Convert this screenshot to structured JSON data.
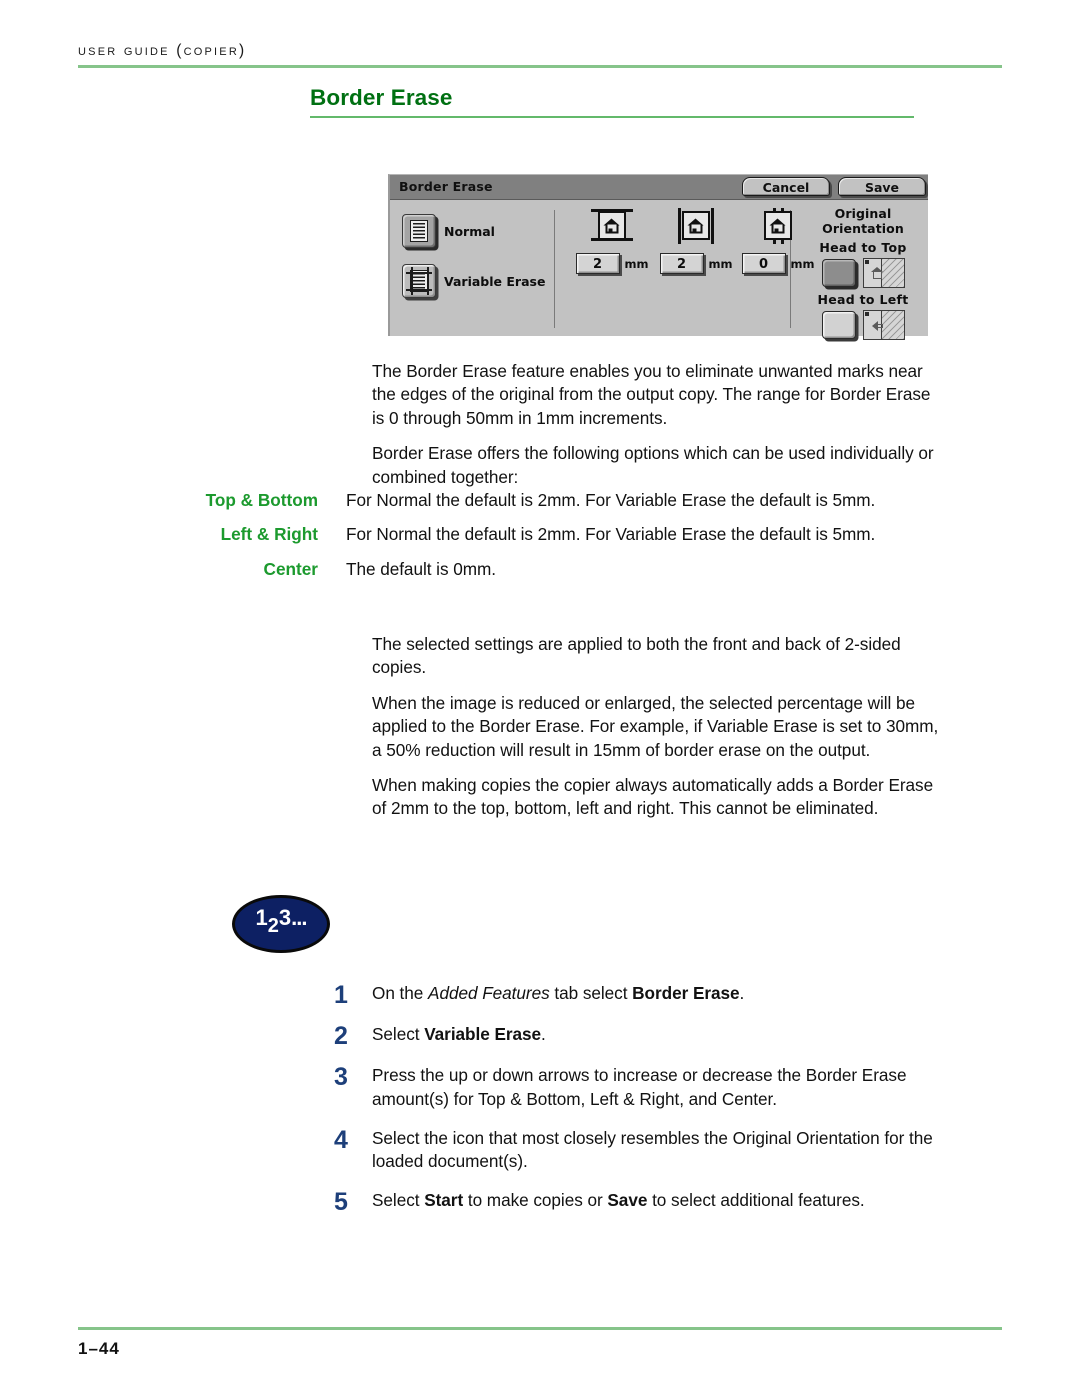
{
  "header": {
    "running_head": "User Guide (Copier)"
  },
  "section": {
    "title": "Border Erase"
  },
  "ui_panel": {
    "title": "Border Erase",
    "cancel_label": "Cancel",
    "save_label": "Save",
    "options": [
      {
        "label": "Normal",
        "selected": true,
        "icon": "document-icon"
      },
      {
        "label": "Variable Erase",
        "selected": false,
        "icon": "document-crop-marks-icon"
      }
    ],
    "amounts": [
      {
        "icon": "house-top-bottom-icon",
        "value": "2",
        "unit": "mm"
      },
      {
        "icon": "house-left-right-icon",
        "value": "2",
        "unit": "mm"
      },
      {
        "icon": "house-center-icon",
        "value": "0",
        "unit": "mm"
      }
    ],
    "orientation": {
      "heading": "Original Orientation",
      "head_to_top_label": "Head to Top",
      "head_to_left_label": "Head to Left",
      "head_to_top_selected": true,
      "head_to_left_selected": false
    }
  },
  "body": {
    "paragraphs_top": [
      "The Border Erase feature enables you to eliminate unwanted marks near the edges of the original from the output copy.  The range for Border Erase is 0 through 50mm in 1mm increments.",
      "Border Erase offers the following options which can be used individually or combined together:"
    ],
    "definitions": [
      {
        "term": "Top & Bottom",
        "description": "For Normal the default is 2mm. For Variable Erase the default is 5mm."
      },
      {
        "term": "Left & Right",
        "description": "For Normal the default is 2mm. For Variable Erase the default is 5mm."
      },
      {
        "term": "Center",
        "description": "The default is 0mm."
      }
    ],
    "paragraphs_bottom": [
      "The selected settings are applied to both the front and back of 2-sided copies.",
      "When the image is reduced or enlarged, the selected percentage will be applied to the Border Erase.  For example, if Variable Erase is set to 30mm, a 50% reduction will result in 15mm of border erase on the output.",
      "When making copies the copier always automatically adds a Border Erase of 2mm to the top, bottom, left and right.  This cannot be eliminated."
    ]
  },
  "procedure": {
    "badge": {
      "part1": "1",
      "part2": "2",
      "part3": "3",
      "dots": "..."
    },
    "steps": [
      {
        "num": "1",
        "text_html": "On the <i>Added Features</i> tab select <b>Border Erase</b>."
      },
      {
        "num": "2",
        "text_html": "Select <b>Variable Erase</b>."
      },
      {
        "num": "3",
        "text_html": "Press the up or down arrows to increase or decrease the Border Erase amount(s) for Top &amp; Bottom, Left &amp; Right, and Center."
      },
      {
        "num": "4",
        "text_html": "Select the icon that most closely resembles the Original Orientation for the loaded document(s)."
      },
      {
        "num": "5",
        "text_html": "Select <b>Start</b> to make copies or <b>Save</b> to select additional features."
      }
    ]
  },
  "footer": {
    "page_number": "1–44"
  },
  "colors": {
    "section_title_green": "#007012",
    "rule_green": "#86c48a",
    "term_green": "#1c9a2e",
    "step_number_blue": "#1d3f7a",
    "badge_navy": "#0d2063",
    "panel_gray": "#c2c2c2",
    "titlebar_gray": "#808080"
  }
}
